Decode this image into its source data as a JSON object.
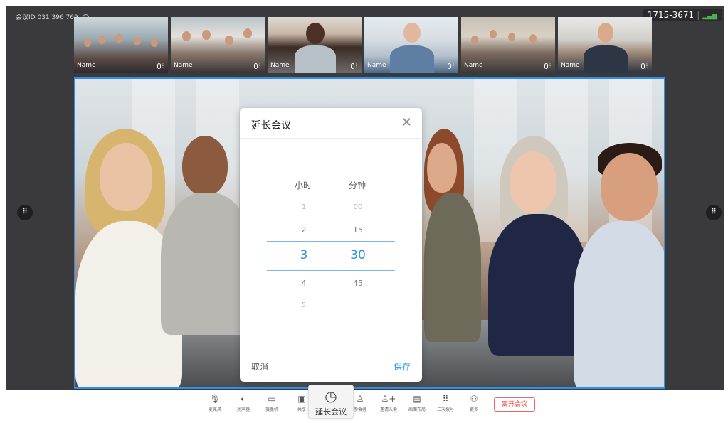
{
  "header": {
    "meeting_id_label": "会议ID",
    "meeting_id": "031 396 769",
    "phone_number": "1715-3671",
    "signal_icon": "signal-icon"
  },
  "participants": [
    {
      "name": "Name"
    },
    {
      "name": "Name"
    },
    {
      "name": "Name"
    },
    {
      "name": "Name"
    },
    {
      "name": "Name"
    },
    {
      "name": "Name"
    }
  ],
  "dialog": {
    "title": "延长会议",
    "hour_label": "小时",
    "minute_label": "分钟",
    "hours": [
      "1",
      "2",
      "3",
      "4",
      "5"
    ],
    "minutes": [
      "00",
      "15",
      "30",
      "45"
    ],
    "selected_hour": "3",
    "selected_minute": "30",
    "cancel_label": "取消",
    "save_label": "保存"
  },
  "toolbar": {
    "items": [
      {
        "label": "麦克风",
        "icon": "microphone-icon"
      },
      {
        "label": "扬声器",
        "icon": "speaker-icon"
      },
      {
        "label": "摄像机",
        "icon": "camera-icon"
      },
      {
        "label": "共享",
        "icon": "share-screen-icon"
      },
      {
        "label": "延长会议",
        "icon": "clock-icon"
      },
      {
        "label": "参会者",
        "icon": "participants-icon"
      },
      {
        "label": "邀请入会",
        "icon": "invite-icon"
      },
      {
        "label": "画面布局",
        "icon": "layout-icon"
      },
      {
        "label": "二次拨号",
        "icon": "dialpad-icon"
      },
      {
        "label": "更多",
        "icon": "more-icon"
      }
    ],
    "leave_label": "离开会议"
  },
  "colors": {
    "accent": "#2f8fe8",
    "leave": "#e84c43",
    "stage": "#3a3a3c"
  }
}
